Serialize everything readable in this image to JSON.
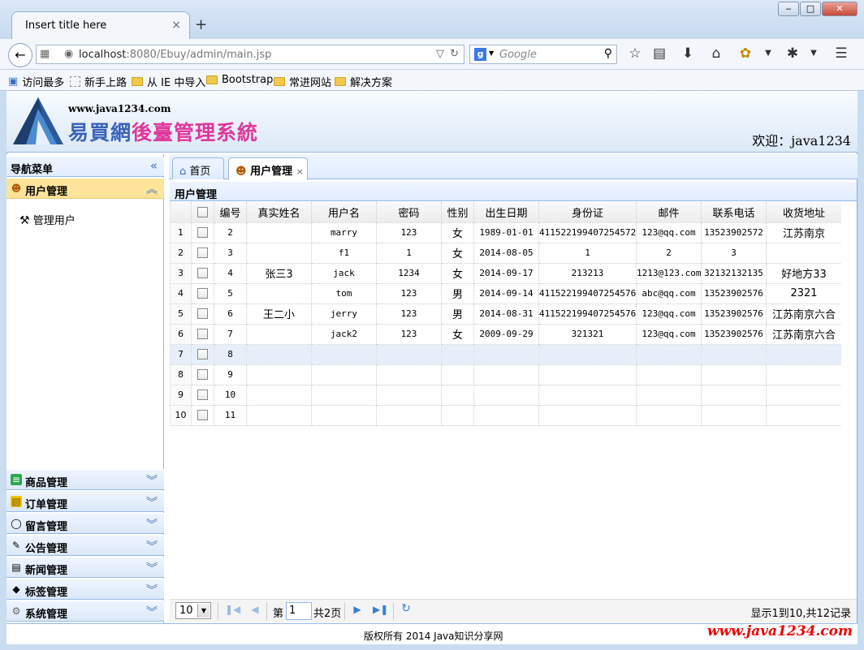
{
  "browser": {
    "tab_title": "Insert title here",
    "tab_close": "×",
    "new_tab": "+",
    "url_host": "localhost",
    "url_rest": ":8080/Ebuy/admin/main.jsp",
    "search_placeholder": "Google",
    "search_engine_letter": "g",
    "window_min": "‒",
    "window_max": "□",
    "window_close": "✕",
    "bookmarks": [
      "访问最多",
      "新手上路",
      "从 IE 中导入",
      "Bootstrap",
      "常进网站",
      "解决方案"
    ]
  },
  "header": {
    "site_url": "www.java1234.com",
    "title_part1": "易買網",
    "title_part2": "後臺管理系統",
    "welcome": "欢迎：java1234"
  },
  "sidebar": {
    "title": "导航菜单",
    "collapse_icon": "«",
    "active_section": {
      "label": "用户管理",
      "icon": "users-icon",
      "chevron": "︽"
    },
    "active_items": [
      {
        "label": "管理用户",
        "icon": "tools-icon"
      }
    ],
    "sections": [
      {
        "label": "商品管理",
        "icon": "list-icon",
        "chevron": "︾"
      },
      {
        "label": "订单管理",
        "icon": "order-icon",
        "chevron": "︾"
      },
      {
        "label": "留言管理",
        "icon": "comment-icon",
        "chevron": "︾"
      },
      {
        "label": "公告管理",
        "icon": "notice-icon",
        "chevron": "︾"
      },
      {
        "label": "新闻管理",
        "icon": "news-icon",
        "chevron": "︾"
      },
      {
        "label": "标签管理",
        "icon": "tag-icon",
        "chevron": "︾"
      },
      {
        "label": "系统管理",
        "icon": "gear-icon",
        "chevron": "︾"
      }
    ]
  },
  "tabs": [
    {
      "label": "首页",
      "icon": "home-icon"
    },
    {
      "label": "用户管理",
      "icon": "users-icon",
      "close": "×"
    }
  ],
  "grid": {
    "title": "用户管理",
    "columns": [
      "编号",
      "真实姓名",
      "用户名",
      "密码",
      "性别",
      "出生日期",
      "身份证",
      "邮件",
      "联系电话",
      "收货地址"
    ],
    "rows": [
      [
        "2",
        "",
        "marry",
        "123",
        "女",
        "1989-01-01",
        "411522199407254572",
        "123@qq.com",
        "13523902572",
        "江苏南京"
      ],
      [
        "3",
        "",
        "f1",
        "1",
        "女",
        "2014-08-05",
        "1",
        "2",
        "3",
        ""
      ],
      [
        "4",
        "张三3",
        "jack",
        "1234",
        "女",
        "2014-09-17",
        "213213",
        "1213@123.com",
        "32132132135",
        "好地方33"
      ],
      [
        "5",
        "",
        "tom",
        "123",
        "男",
        "2014-09-14",
        "411522199407254576",
        "abc@qq.com",
        "13523902576",
        "2321"
      ],
      [
        "6",
        "王二小",
        "jerry",
        "123",
        "男",
        "2014-08-31",
        "411522199407254576",
        "123@qq.com",
        "13523902576",
        "江苏南京六合"
      ],
      [
        "7",
        "",
        "jack2",
        "123",
        "女",
        "2009-09-29",
        "321321",
        "123@qq.com",
        "13523902576",
        "江苏南京六合"
      ],
      [
        "8",
        "",
        "",
        "",
        "",
        "",
        "",
        "",
        "",
        ""
      ],
      [
        "9",
        "",
        "",
        "",
        "",
        "",
        "",
        "",
        "",
        ""
      ],
      [
        "10",
        "",
        "",
        "",
        "",
        "",
        "",
        "",
        "",
        ""
      ],
      [
        "11",
        "",
        "",
        "",
        "",
        "",
        "",
        "",
        "",
        ""
      ]
    ],
    "selected_row": 7
  },
  "pager": {
    "page_size": "10",
    "page_prefix": "第",
    "page_value": "1",
    "page_suffix": "共2页",
    "info": "显示1到10,共12记录"
  },
  "footer": {
    "copyright": "版权所有 2014 Java知识分享网",
    "watermark": "www.java1234.com"
  }
}
